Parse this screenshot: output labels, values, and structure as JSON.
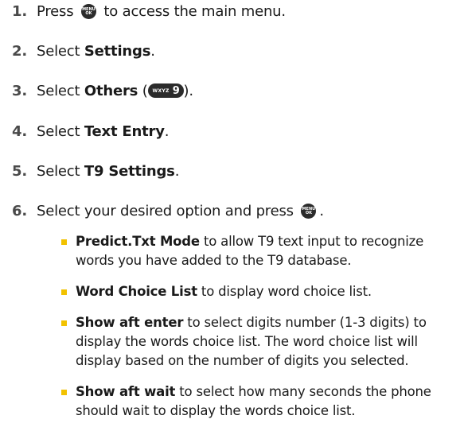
{
  "steps": [
    {
      "num": "1.",
      "pre": "Press ",
      "post": " to access the main menu."
    },
    {
      "num": "2.",
      "pre": "Select ",
      "bold": "Settings",
      "post": "."
    },
    {
      "num": "3.",
      "pre": "Select ",
      "bold": "Others",
      "mid": " (",
      "post": ")."
    },
    {
      "num": "4.",
      "pre": "Select ",
      "bold": "Text Entry",
      "post": "."
    },
    {
      "num": "5.",
      "pre": "Select ",
      "bold": "T9 Settings",
      "post": "."
    },
    {
      "num": "6.",
      "pre": "Select your desired option and press ",
      "post": "."
    }
  ],
  "menu_key": {
    "line1": "MENU",
    "line2": "OK"
  },
  "key_9": {
    "letters": "WXYZ",
    "digit": "9"
  },
  "bullets": [
    {
      "bold": "Predict.Txt Mode",
      "text": " to allow T9 text input to recognize words you have added to the T9 database."
    },
    {
      "bold": "Word Choice List",
      "text": " to display word choice list."
    },
    {
      "bold": "Show aft enter",
      "text": " to select digits number (1-3 digits) to display the words choice list. The word choice list will display based on the number of digits you selected."
    },
    {
      "bold": "Show aft wait",
      "text": " to select how many seconds the phone should wait to display the words choice list."
    }
  ],
  "colors": {
    "bullet": "#f2c200",
    "key": "#2b2b2b",
    "number": "#4a4a4a"
  }
}
